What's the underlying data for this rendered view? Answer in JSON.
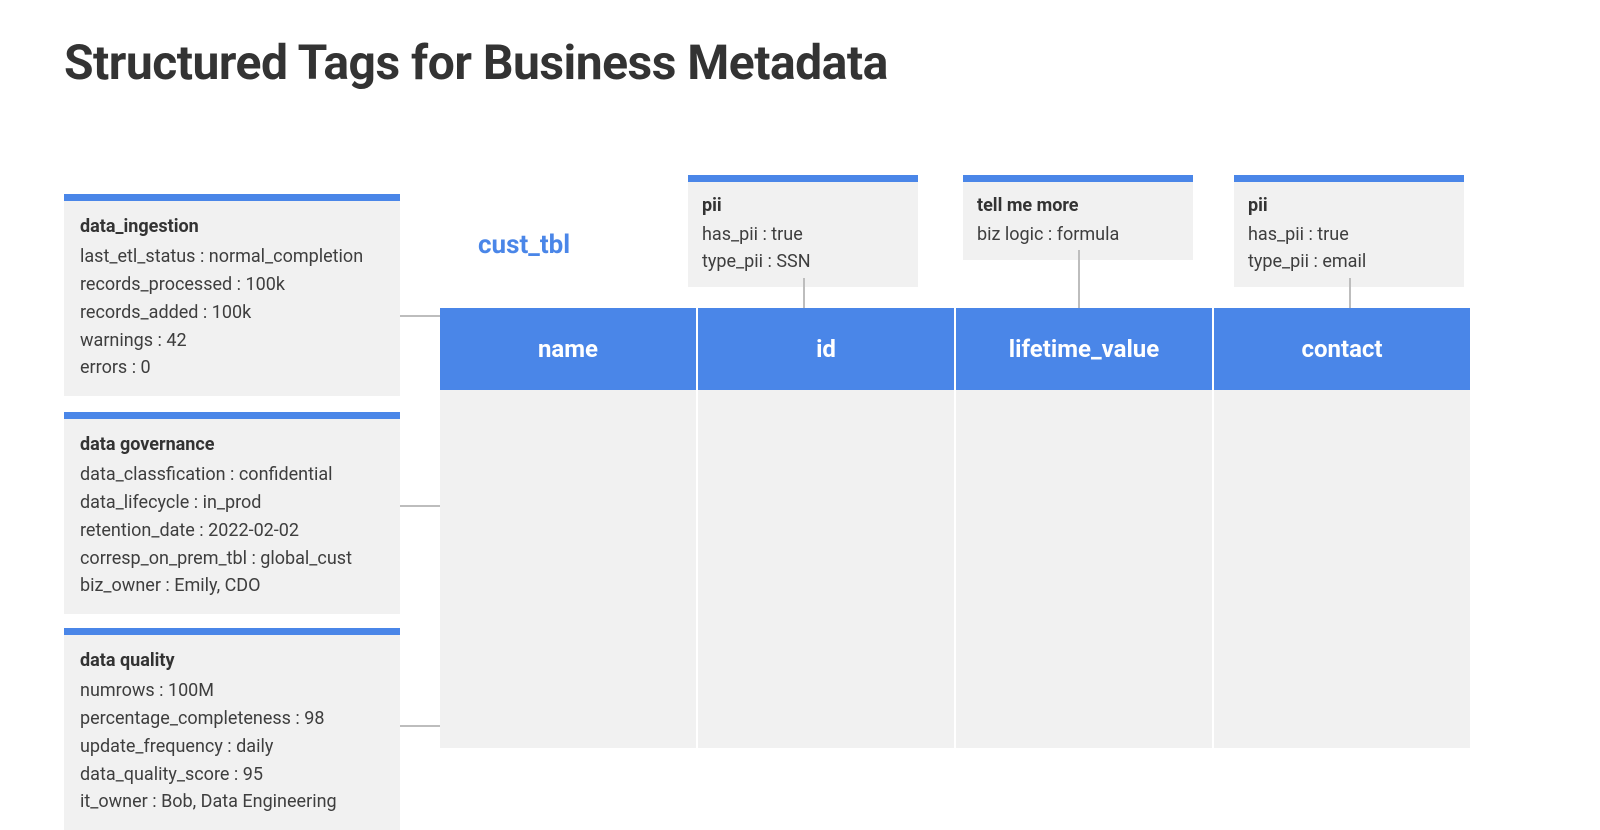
{
  "title": "Structured Tags for Business Metadata",
  "table": {
    "name": "cust_tbl",
    "columns": [
      "name",
      "id",
      "lifetime_value",
      "contact"
    ]
  },
  "table_tags": [
    {
      "name": "data_ingestion",
      "kv": [
        [
          "last_etl_status",
          "normal_completion"
        ],
        [
          "records_processed",
          "100k"
        ],
        [
          "records_added",
          "100k"
        ],
        [
          "warnings",
          "42"
        ],
        [
          "errors",
          "0"
        ]
      ]
    },
    {
      "name": "data governance",
      "kv": [
        [
          "data_classfication",
          "confidential"
        ],
        [
          "data_lifecycle",
          "in_prod"
        ],
        [
          "retention_date",
          "2022-02-02"
        ],
        [
          "corresp_on_prem_tbl",
          "global_cust"
        ],
        [
          "biz_owner",
          "Emily, CDO"
        ]
      ]
    },
    {
      "name": "data quality",
      "kv": [
        [
          "numrows",
          "100M"
        ],
        [
          "percentage_completeness",
          "98"
        ],
        [
          "update_frequency",
          "daily"
        ],
        [
          "data_quality_score",
          "95"
        ],
        [
          "it_owner",
          "Bob, Data Engineering"
        ]
      ]
    }
  ],
  "column_tags": [
    {
      "column": "id",
      "name": "pii",
      "kv": [
        [
          "has_pii",
          "true"
        ],
        [
          "type_pii",
          "SSN"
        ]
      ]
    },
    {
      "column": "lifetime_value",
      "name": "tell me more",
      "kv": [
        [
          "biz logic",
          "formula"
        ]
      ]
    },
    {
      "column": "contact",
      "name": "pii",
      "kv": [
        [
          "has_pii",
          "true"
        ],
        [
          "type_pii",
          "email"
        ]
      ]
    }
  ]
}
